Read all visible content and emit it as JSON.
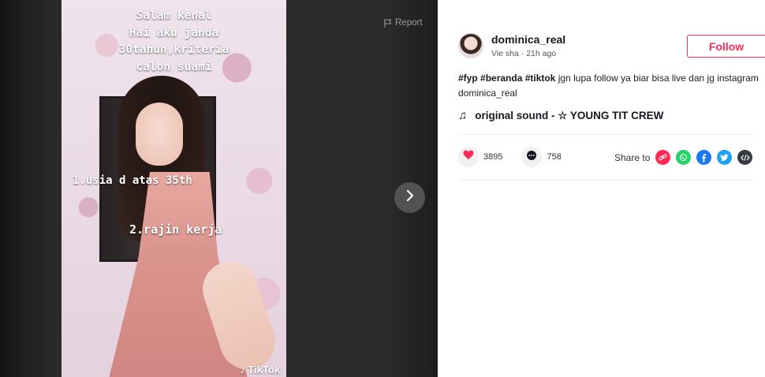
{
  "video": {
    "caption_lines": [
      "Salam kenal",
      "Hai aku janda",
      "30tahun,kriteria",
      "calon suami"
    ],
    "requirement_1": "1.usia d atas 35th",
    "requirement_2": "2.rajin kerja",
    "watermark": "TikTok",
    "watermark_icon": "tiktok-note-icon"
  },
  "stage": {
    "report_label": "Report",
    "report_icon": "flag-icon",
    "next_icon": "chevron-right-icon"
  },
  "post": {
    "username": "dominica_real",
    "display_name": "Vie sha",
    "separator": "·",
    "time_ago": "21h ago",
    "follow_label": "Follow",
    "hashtags": [
      "#fyp",
      "#beranda",
      "#tiktok"
    ],
    "description_text": " jgn lupa follow ya biar bisa live dan jg instagram dominica_real",
    "sound_icon": "music-note-icon",
    "sound_title": "original sound - ☆ YOUNG TIT CREW"
  },
  "metrics": {
    "likes": "3895",
    "comments": "758",
    "like_icon": "heart-icon",
    "comment_icon": "comment-icon"
  },
  "share": {
    "label": "Share to",
    "targets": [
      {
        "name": "copy-link",
        "icon": "link-icon",
        "color": "#fe2c55"
      },
      {
        "name": "whatsapp",
        "icon": "whatsapp-icon",
        "color": "#25d366"
      },
      {
        "name": "facebook",
        "icon": "facebook-icon",
        "color": "#1877f2"
      },
      {
        "name": "twitter",
        "icon": "twitter-icon",
        "color": "#1da1f2"
      },
      {
        "name": "embed",
        "icon": "embed-icon",
        "color": "#161823"
      }
    ]
  },
  "colors": {
    "accent": "#fe2c55",
    "text_primary": "#161823",
    "stage_bg": "#2b2b2b"
  }
}
